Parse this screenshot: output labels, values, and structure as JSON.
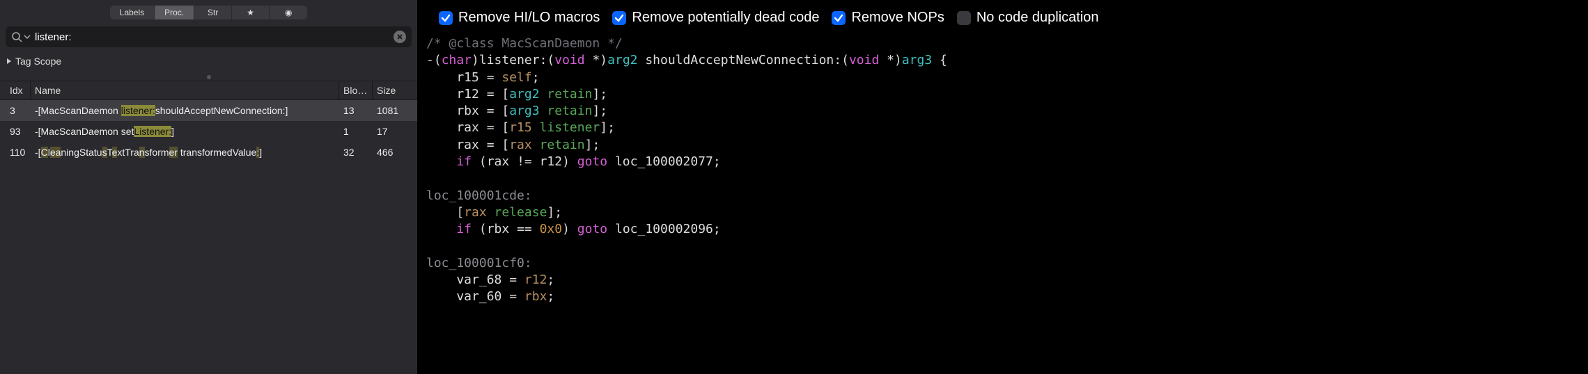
{
  "tabs": {
    "labels": "Labels",
    "proc": "Proc.",
    "str": "Str",
    "star_icon": "★",
    "dot_icon": "◉",
    "selected": 1
  },
  "search": {
    "value": "listener:",
    "placeholder": "Search"
  },
  "tagscope": {
    "label": "Tag Scope"
  },
  "table": {
    "headers": {
      "idx": "Idx",
      "name": "Name",
      "blo": "Blo…",
      "size": "Size"
    },
    "rows": [
      {
        "idx": "3",
        "name_parts": [
          {
            "t": "-[MacScanDaemon ",
            "h": 0
          },
          {
            "t": "listener:",
            "h": 1
          },
          {
            "t": "shouldAcceptNewConnection:]",
            "h": 0
          }
        ],
        "blo": "13",
        "size": "1081",
        "selected": true
      },
      {
        "idx": "93",
        "name_parts": [
          {
            "t": "-[MacScanDaemon set",
            "h": 0
          },
          {
            "t": "Listener:",
            "h": 1
          },
          {
            "t": "]",
            "h": 0
          }
        ],
        "blo": "1",
        "size": "17",
        "selected": false
      },
      {
        "idx": "110",
        "name_parts": [
          {
            "t": "-[",
            "h": 0
          },
          {
            "t": "C",
            "h": 2
          },
          {
            "t": "l",
            "h": 0
          },
          {
            "t": "ea",
            "h": 2
          },
          {
            "t": "ningStatu",
            "h": 0
          },
          {
            "t": "s",
            "h": 2
          },
          {
            "t": "T",
            "h": 0
          },
          {
            "t": "e",
            "h": 2
          },
          {
            "t": "xtTra",
            "h": 0
          },
          {
            "t": "n",
            "h": 2
          },
          {
            "t": "sform",
            "h": 0
          },
          {
            "t": "er",
            "h": 2
          },
          {
            "t": " transformedValue",
            "h": 0
          },
          {
            "t": ":",
            "h": 2
          },
          {
            "t": "]",
            "h": 0
          }
        ],
        "blo": "32",
        "size": "466",
        "selected": false
      }
    ]
  },
  "options": [
    {
      "label": "Remove HI/LO macros",
      "checked": true
    },
    {
      "label": "Remove potentially dead code",
      "checked": true
    },
    {
      "label": "Remove NOPs",
      "checked": true
    },
    {
      "label": "No code duplication",
      "checked": false
    }
  ],
  "code": {
    "tokens": [
      [
        {
          "t": "/* @class MacScanDaemon */",
          "c": "c-comment"
        }
      ],
      [
        {
          "t": "-(",
          "c": "c-punc"
        },
        {
          "t": "char",
          "c": "c-type"
        },
        {
          "t": ")listener:(",
          "c": "c-punc"
        },
        {
          "t": "void",
          "c": "c-type"
        },
        {
          "t": " *)",
          "c": "c-punc"
        },
        {
          "t": "arg2",
          "c": "c-arg"
        },
        {
          "t": " shouldAcceptNewConnection:(",
          "c": "c-punc"
        },
        {
          "t": "void",
          "c": "c-type"
        },
        {
          "t": " *)",
          "c": "c-punc"
        },
        {
          "t": "arg3",
          "c": "c-arg"
        },
        {
          "t": " {",
          "c": "c-punc"
        }
      ],
      [
        {
          "t": "    r15 = ",
          "c": "c-reg"
        },
        {
          "t": "self",
          "c": "c-id"
        },
        {
          "t": ";",
          "c": "c-punc"
        }
      ],
      [
        {
          "t": "    r12 = [",
          "c": "c-reg"
        },
        {
          "t": "arg2",
          "c": "c-arg"
        },
        {
          "t": " ",
          "c": "c-punc"
        },
        {
          "t": "retain",
          "c": "c-func"
        },
        {
          "t": "];",
          "c": "c-punc"
        }
      ],
      [
        {
          "t": "    rbx = [",
          "c": "c-reg"
        },
        {
          "t": "arg3",
          "c": "c-arg"
        },
        {
          "t": " ",
          "c": "c-punc"
        },
        {
          "t": "retain",
          "c": "c-func"
        },
        {
          "t": "];",
          "c": "c-punc"
        }
      ],
      [
        {
          "t": "    rax = [",
          "c": "c-reg"
        },
        {
          "t": "r15",
          "c": "c-id"
        },
        {
          "t": " ",
          "c": "c-punc"
        },
        {
          "t": "listener",
          "c": "c-func"
        },
        {
          "t": "];",
          "c": "c-punc"
        }
      ],
      [
        {
          "t": "    rax = [",
          "c": "c-reg"
        },
        {
          "t": "rax",
          "c": "c-id"
        },
        {
          "t": " ",
          "c": "c-punc"
        },
        {
          "t": "retain",
          "c": "c-func"
        },
        {
          "t": "];",
          "c": "c-punc"
        }
      ],
      [
        {
          "t": "    ",
          "c": "c-punc"
        },
        {
          "t": "if",
          "c": "c-keyword"
        },
        {
          "t": " (rax != r12) ",
          "c": "c-punc"
        },
        {
          "t": "goto",
          "c": "c-keyword"
        },
        {
          "t": " loc_100002077;",
          "c": "c-punc"
        }
      ],
      [
        {
          "t": "",
          "c": ""
        }
      ],
      [
        {
          "t": "loc_100001cde:",
          "c": "c-label"
        }
      ],
      [
        {
          "t": "    [",
          "c": "c-punc"
        },
        {
          "t": "rax",
          "c": "c-id"
        },
        {
          "t": " ",
          "c": "c-punc"
        },
        {
          "t": "release",
          "c": "c-func"
        },
        {
          "t": "];",
          "c": "c-punc"
        }
      ],
      [
        {
          "t": "    ",
          "c": "c-punc"
        },
        {
          "t": "if",
          "c": "c-keyword"
        },
        {
          "t": " (rbx == ",
          "c": "c-punc"
        },
        {
          "t": "0x0",
          "c": "c-num"
        },
        {
          "t": ") ",
          "c": "c-punc"
        },
        {
          "t": "goto",
          "c": "c-keyword"
        },
        {
          "t": " loc_100002096;",
          "c": "c-punc"
        }
      ],
      [
        {
          "t": "",
          "c": ""
        }
      ],
      [
        {
          "t": "loc_100001cf0:",
          "c": "c-label"
        }
      ],
      [
        {
          "t": "    var_68 = ",
          "c": "c-reg"
        },
        {
          "t": "r12",
          "c": "c-id"
        },
        {
          "t": ";",
          "c": "c-punc"
        }
      ],
      [
        {
          "t": "    var_60 = ",
          "c": "c-reg"
        },
        {
          "t": "rbx",
          "c": "c-id"
        },
        {
          "t": ";",
          "c": "c-punc"
        }
      ]
    ]
  }
}
